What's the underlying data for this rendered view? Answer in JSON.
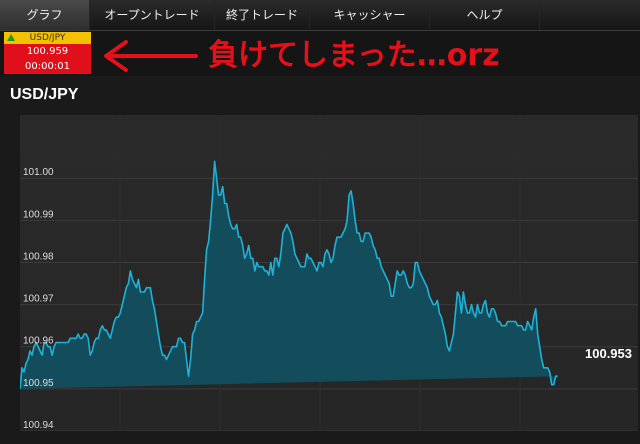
{
  "nav": {
    "tabs": [
      {
        "label": "グラフ",
        "active": true
      },
      {
        "label": "オープントレード",
        "active": false
      },
      {
        "label": "終了トレード",
        "active": false
      },
      {
        "label": "キャッシャー",
        "active": false
      },
      {
        "label": "ヘルプ",
        "active": false
      }
    ]
  },
  "ticker": {
    "symbol": "USD/JPY",
    "price": "100.959",
    "timer": "00:00:01",
    "direction": "up"
  },
  "annotation": {
    "text": "負けてしまった…orz"
  },
  "chart": {
    "title": "USD/JPY"
  },
  "chart_data": {
    "type": "area",
    "title": "USD/JPY",
    "xlabel": "",
    "ylabel": "",
    "ylim": [
      100.94,
      101.015
    ],
    "y_ticks": [
      "101.00",
      "100.99",
      "100.98",
      "100.97",
      "100.96",
      "100.95",
      "100.94"
    ],
    "y_tick_values": [
      101.0,
      100.99,
      100.98,
      100.97,
      100.96,
      100.95,
      100.94
    ],
    "grid": true,
    "last_value": "100.953",
    "line_color": "#1fb2d8",
    "fill_color": "#115060",
    "x": [
      0,
      2,
      4,
      6,
      8,
      10,
      12,
      14,
      16,
      18,
      20,
      22,
      24,
      26,
      28,
      30,
      32,
      34,
      36,
      38,
      40,
      42,
      44,
      46,
      48,
      50,
      52,
      54,
      56,
      58,
      60,
      62,
      64,
      66,
      68,
      70,
      72,
      74,
      76,
      78,
      80,
      82,
      84,
      86,
      88,
      90,
      92,
      94,
      96,
      98,
      100,
      102,
      104,
      106,
      108,
      110,
      112,
      114,
      116,
      118,
      120,
      122,
      124,
      126,
      128,
      130,
      132,
      134,
      136,
      138,
      140,
      142,
      144,
      146,
      148,
      150,
      152,
      154,
      156,
      158,
      160,
      162,
      164,
      166,
      168,
      170,
      172,
      174,
      176,
      178,
      180,
      182,
      184,
      186,
      188,
      190,
      192,
      194,
      196,
      198,
      200,
      202,
      204,
      206,
      208,
      210,
      212,
      214,
      216,
      218,
      220,
      222,
      224,
      226,
      228,
      230,
      232,
      234,
      236,
      238,
      240,
      242,
      244,
      246,
      248,
      250,
      252,
      254,
      256,
      258,
      260,
      262,
      264,
      266,
      268,
      270,
      272,
      274,
      276,
      278,
      280,
      282,
      284,
      286,
      288,
      290,
      292,
      294,
      296,
      298,
      300,
      302,
      304,
      306,
      308,
      310,
      312,
      314,
      316,
      318,
      320,
      322,
      324,
      326,
      328,
      330,
      332,
      334,
      336,
      338,
      340,
      342,
      344,
      346,
      348,
      350,
      352,
      354,
      356,
      358,
      360,
      362,
      364,
      366,
      368,
      370,
      372,
      374,
      376,
      378,
      380,
      382,
      384,
      386,
      388,
      390,
      392,
      394,
      396,
      398,
      400,
      402,
      404,
      406,
      408,
      410,
      412,
      414,
      416,
      418,
      420,
      422,
      424,
      426,
      428,
      430,
      432,
      434,
      436,
      438,
      440,
      442,
      444,
      446,
      448,
      450,
      452,
      454,
      456,
      458,
      460,
      462,
      464,
      466,
      468,
      470,
      472,
      474,
      476,
      478,
      480,
      482,
      484,
      486,
      488,
      490,
      492,
      494,
      496,
      498,
      500,
      502,
      504,
      506,
      508,
      510,
      512,
      514,
      516,
      518,
      520,
      522,
      524,
      526,
      528,
      530,
      532,
      534,
      536,
      538,
      540,
      542,
      544,
      546,
      548,
      550,
      552,
      554,
      556,
      558,
      560,
      562,
      564,
      566,
      568,
      570,
      572,
      574,
      576,
      578,
      580,
      582,
      584,
      586,
      588,
      590,
      592,
      594,
      596,
      598,
      600,
      602,
      604,
      606,
      608,
      610,
      612,
      614
    ],
    "values": [
      100.95,
      100.955,
      100.954,
      100.956,
      100.957,
      100.959,
      100.958,
      100.96,
      100.961,
      100.96,
      100.959,
      100.958,
      100.961,
      100.961,
      100.96,
      100.96,
      100.958,
      100.96,
      100.961,
      100.961,
      100.961,
      100.961,
      100.961,
      100.961,
      100.961,
      100.962,
      100.962,
      100.962,
      100.962,
      100.963,
      100.962,
      100.962,
      100.963,
      100.963,
      100.962,
      100.958,
      100.959,
      100.961,
      100.962,
      100.962,
      100.964,
      100.965,
      100.964,
      100.964,
      100.963,
      100.962,
      100.964,
      100.966,
      100.967,
      100.967,
      100.968,
      100.97,
      100.972,
      100.974,
      100.975,
      100.978,
      100.976,
      100.975,
      100.974,
      100.976,
      100.973,
      100.973,
      100.973,
      100.974,
      100.974,
      100.974,
      100.971,
      100.969,
      100.966,
      100.963,
      100.96,
      100.958,
      100.958,
      100.957,
      100.958,
      100.959,
      100.96,
      100.96,
      100.96,
      100.962,
      100.962,
      100.961,
      100.961,
      100.957,
      100.953,
      100.957,
      100.963,
      100.964,
      100.966,
      100.966,
      100.967,
      100.968,
      100.976,
      100.983,
      100.985,
      100.99,
      100.996,
      101.004,
      101.0,
      100.996,
      100.996,
      100.998,
      100.994,
      100.994,
      100.991,
      100.989,
      100.988,
      100.988,
      100.989,
      100.986,
      100.986,
      100.984,
      100.981,
      100.982,
      100.984,
      100.981,
      100.981,
      100.978,
      100.98,
      100.979,
      100.979,
      100.979,
      100.978,
      100.978,
      100.977,
      100.98,
      100.977,
      100.981,
      100.981,
      100.979,
      100.982,
      100.987,
      100.988,
      100.989,
      100.988,
      100.987,
      100.985,
      100.982,
      100.981,
      100.98,
      100.979,
      100.979,
      100.979,
      100.982,
      100.981,
      100.981,
      100.98,
      100.979,
      100.978,
      100.98,
      100.98,
      100.979,
      100.982,
      100.983,
      100.982,
      100.98,
      100.981,
      100.984,
      100.986,
      100.986,
      100.986,
      100.987,
      100.988,
      100.99,
      100.996,
      100.997,
      100.994,
      100.99,
      100.987,
      100.987,
      100.985,
      100.985,
      100.987,
      100.987,
      100.987,
      100.986,
      100.984,
      100.983,
      100.981,
      100.981,
      100.979,
      100.978,
      100.977,
      100.976,
      100.975,
      100.972,
      100.972,
      100.975,
      100.978,
      100.977,
      100.977,
      100.978,
      100.977,
      100.975,
      100.974,
      100.974,
      100.975,
      100.98,
      100.98,
      100.978,
      100.977,
      100.976,
      100.975,
      100.974,
      100.972,
      100.971,
      100.97,
      100.97,
      100.971,
      100.968,
      100.967,
      100.965,
      100.963,
      100.96,
      100.959,
      100.961,
      100.963,
      100.968,
      100.973,
      100.972,
      100.968,
      100.973,
      100.97,
      100.968,
      100.968,
      100.97,
      100.968,
      100.967,
      100.97,
      100.968,
      100.968,
      100.97,
      100.971,
      100.968,
      100.967,
      100.969,
      100.969,
      100.968,
      100.966,
      100.966,
      100.965,
      100.965,
      100.965,
      100.966,
      100.966,
      100.966,
      100.966,
      100.966,
      100.965,
      100.965,
      100.965,
      100.964,
      100.964,
      100.966,
      100.965,
      100.964,
      100.967,
      100.969,
      100.963,
      100.96,
      100.957,
      100.955,
      100.955,
      100.955,
      100.954,
      100.951,
      100.951,
      100.953,
      100.953
    ]
  }
}
